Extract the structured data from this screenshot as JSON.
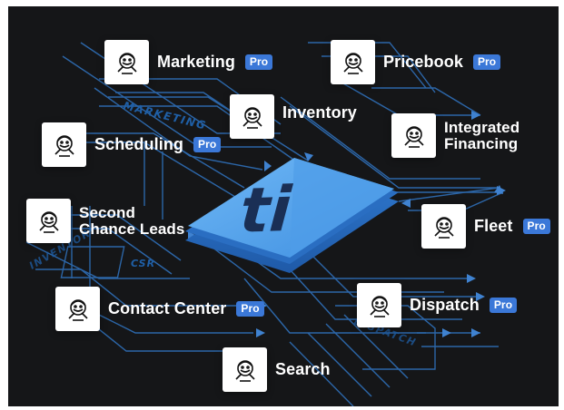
{
  "center": {
    "logo_text": "ti"
  },
  "board_labels": [
    {
      "key": "marketing",
      "text": "MARKETING"
    },
    {
      "key": "csr",
      "text": "CSR"
    },
    {
      "key": "inventory",
      "text": "INVENTORY"
    },
    {
      "key": "dispatch",
      "text": "DISPATCH"
    }
  ],
  "modules": [
    {
      "key": "marketing",
      "label": "Marketing",
      "pro": "Pro"
    },
    {
      "key": "pricebook",
      "label": "Pricebook",
      "pro": "Pro"
    },
    {
      "key": "inventory",
      "label": "Inventory",
      "pro": ""
    },
    {
      "key": "integrated-financing",
      "label": "Integrated\nFinancing",
      "pro": ""
    },
    {
      "key": "scheduling",
      "label": "Scheduling",
      "pro": "Pro"
    },
    {
      "key": "second-chance-leads",
      "label": "Second\nChance Leads",
      "pro": ""
    },
    {
      "key": "fleet",
      "label": "Fleet",
      "pro": "Pro"
    },
    {
      "key": "contact-center",
      "label": "Contact Center",
      "pro": "Pro"
    },
    {
      "key": "dispatch",
      "label": "Dispatch",
      "pro": "Pro"
    },
    {
      "key": "search",
      "label": "Search",
      "pro": ""
    }
  ],
  "colors": {
    "background": "#151618",
    "circuit_lines": "#2f6fb8",
    "chip_top": "#5aa8f0",
    "chip_side": "#2f6fc0",
    "pro_badge": "#3b78d8"
  },
  "icon": "mascot-icon"
}
